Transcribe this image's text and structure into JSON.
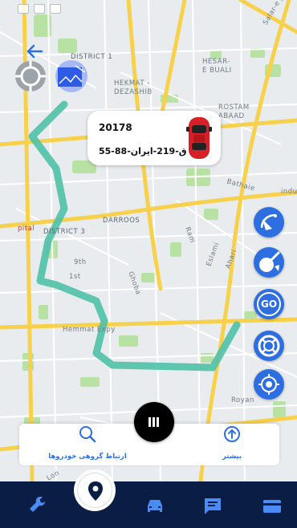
{
  "map": {
    "labels": {
      "district1": "DISTRICT 1",
      "hesarEBuali": "HESAR-",
      "hesarEBuali2": "E BUALI",
      "hekmatDezashib": "HEKMAT -",
      "hekmatDezashib2": "DEZASHIB",
      "rostamAbaad": "ROSTAM",
      "rostamAbaad2": "ABAAD",
      "saltar": "Salar-e Jange",
      "darroos": "DARROOS",
      "district3": "DISTRICT 3",
      "bathaie": "Bathaie",
      "hemmatExpy": "Hemmat Expy",
      "pital": "pital",
      "ninth": "9th",
      "first": "1st",
      "ghoba": "Ghoba",
      "ram": "Ram",
      "estami": "Eslami",
      "aghari": "Ahari",
      "royan": "Royan",
      "indu": "indu",
      "lon": "Lon"
    },
    "colors": {
      "route": "#4fc1a6",
      "road_major": "#f7d14b",
      "road_minor": "#ffffff",
      "park": "#b8e2a4",
      "map_bg": "#e9ecef"
    }
  },
  "controls": {
    "back_icon": "arrow-left-icon",
    "compass_icon": "compass-icon",
    "layers_icon": "layers-icon"
  },
  "vehicle_card": {
    "vehicle_id": "20178",
    "plate": "55-ق-219-ایران-88",
    "car_icon": "red-car-icon"
  },
  "right_buttons": [
    {
      "name": "satellite-button",
      "icon": "satellite-dish-icon"
    },
    {
      "name": "clean-button",
      "icon": "broom-icon"
    },
    {
      "name": "go-button",
      "label": "GO"
    },
    {
      "name": "lifebuoy-button",
      "icon": "lifebuoy-icon"
    },
    {
      "name": "locate-button",
      "icon": "crosshair-icon"
    }
  ],
  "bottom_panel": {
    "group_link_label": "ارتباط گروهی خودروها",
    "more_label": "بیشتر"
  },
  "nav": {
    "items": [
      "wrench-icon",
      "location-pin-icon",
      "car-icon",
      "message-icon",
      "card-icon"
    ],
    "active": "location-pin-icon"
  },
  "accent": "#2d6ee0",
  "nav_bg": "#0a1d45"
}
